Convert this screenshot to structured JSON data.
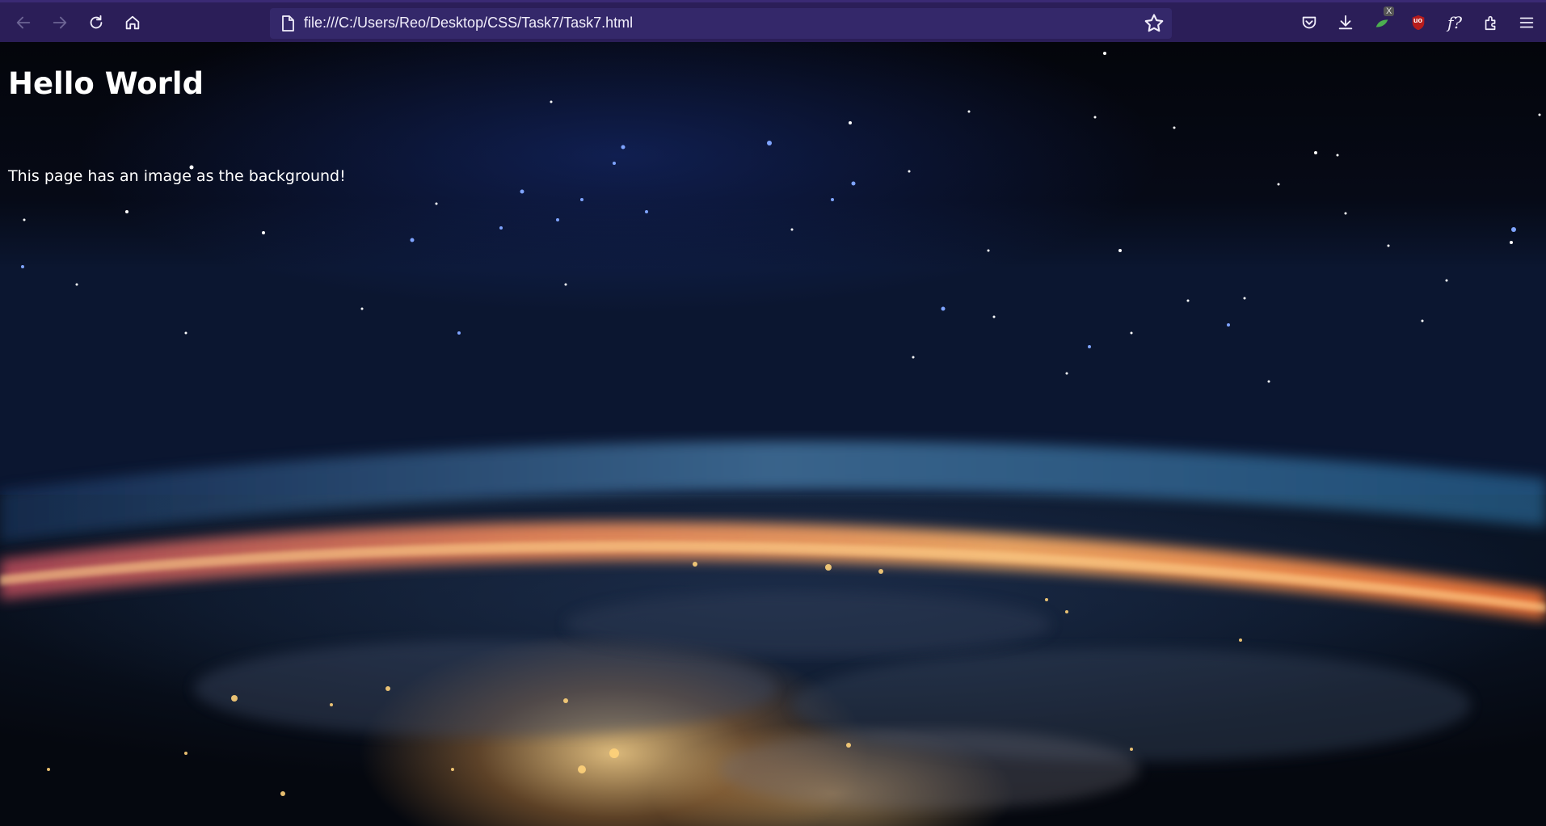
{
  "browser": {
    "url": "file:///C:/Users/Reo/Desktop/CSS/Task7/Task7.html",
    "nav_icons": [
      "back-icon",
      "forward-icon",
      "reload-icon",
      "home-icon"
    ],
    "toolbar_icons": [
      "pocket-icon",
      "downloads-icon",
      "extension-x-icon",
      "ublock-icon",
      "font-finder-icon",
      "extensions-icon",
      "menu-icon"
    ],
    "extension_badge": "X",
    "ublock_label": "uo",
    "font_finder_label": "f?"
  },
  "page": {
    "heading": "Hello World",
    "paragraph": "This page has an image as the background!"
  },
  "colors": {
    "toolbar": "#2b1e58",
    "urlbar": "#34286a",
    "text": "#ffffff"
  }
}
